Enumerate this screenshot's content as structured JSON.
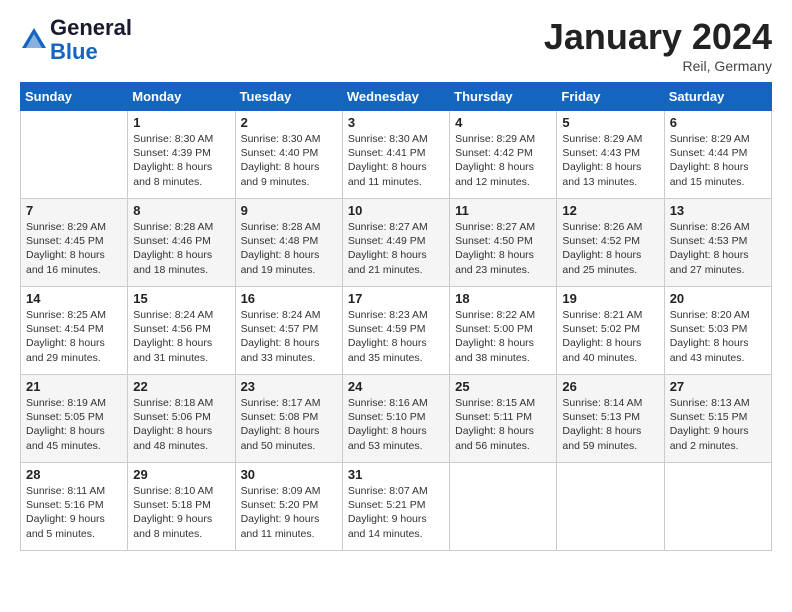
{
  "header": {
    "logo_line1": "General",
    "logo_line2": "Blue",
    "month": "January 2024",
    "location": "Reil, Germany"
  },
  "weekdays": [
    "Sunday",
    "Monday",
    "Tuesday",
    "Wednesday",
    "Thursday",
    "Friday",
    "Saturday"
  ],
  "weeks": [
    [
      {
        "day": "",
        "detail": ""
      },
      {
        "day": "1",
        "detail": "Sunrise: 8:30 AM\nSunset: 4:39 PM\nDaylight: 8 hours\nand 8 minutes."
      },
      {
        "day": "2",
        "detail": "Sunrise: 8:30 AM\nSunset: 4:40 PM\nDaylight: 8 hours\nand 9 minutes."
      },
      {
        "day": "3",
        "detail": "Sunrise: 8:30 AM\nSunset: 4:41 PM\nDaylight: 8 hours\nand 11 minutes."
      },
      {
        "day": "4",
        "detail": "Sunrise: 8:29 AM\nSunset: 4:42 PM\nDaylight: 8 hours\nand 12 minutes."
      },
      {
        "day": "5",
        "detail": "Sunrise: 8:29 AM\nSunset: 4:43 PM\nDaylight: 8 hours\nand 13 minutes."
      },
      {
        "day": "6",
        "detail": "Sunrise: 8:29 AM\nSunset: 4:44 PM\nDaylight: 8 hours\nand 15 minutes."
      }
    ],
    [
      {
        "day": "7",
        "detail": "Sunrise: 8:29 AM\nSunset: 4:45 PM\nDaylight: 8 hours\nand 16 minutes."
      },
      {
        "day": "8",
        "detail": "Sunrise: 8:28 AM\nSunset: 4:46 PM\nDaylight: 8 hours\nand 18 minutes."
      },
      {
        "day": "9",
        "detail": "Sunrise: 8:28 AM\nSunset: 4:48 PM\nDaylight: 8 hours\nand 19 minutes."
      },
      {
        "day": "10",
        "detail": "Sunrise: 8:27 AM\nSunset: 4:49 PM\nDaylight: 8 hours\nand 21 minutes."
      },
      {
        "day": "11",
        "detail": "Sunrise: 8:27 AM\nSunset: 4:50 PM\nDaylight: 8 hours\nand 23 minutes."
      },
      {
        "day": "12",
        "detail": "Sunrise: 8:26 AM\nSunset: 4:52 PM\nDaylight: 8 hours\nand 25 minutes."
      },
      {
        "day": "13",
        "detail": "Sunrise: 8:26 AM\nSunset: 4:53 PM\nDaylight: 8 hours\nand 27 minutes."
      }
    ],
    [
      {
        "day": "14",
        "detail": "Sunrise: 8:25 AM\nSunset: 4:54 PM\nDaylight: 8 hours\nand 29 minutes."
      },
      {
        "day": "15",
        "detail": "Sunrise: 8:24 AM\nSunset: 4:56 PM\nDaylight: 8 hours\nand 31 minutes."
      },
      {
        "day": "16",
        "detail": "Sunrise: 8:24 AM\nSunset: 4:57 PM\nDaylight: 8 hours\nand 33 minutes."
      },
      {
        "day": "17",
        "detail": "Sunrise: 8:23 AM\nSunset: 4:59 PM\nDaylight: 8 hours\nand 35 minutes."
      },
      {
        "day": "18",
        "detail": "Sunrise: 8:22 AM\nSunset: 5:00 PM\nDaylight: 8 hours\nand 38 minutes."
      },
      {
        "day": "19",
        "detail": "Sunrise: 8:21 AM\nSunset: 5:02 PM\nDaylight: 8 hours\nand 40 minutes."
      },
      {
        "day": "20",
        "detail": "Sunrise: 8:20 AM\nSunset: 5:03 PM\nDaylight: 8 hours\nand 43 minutes."
      }
    ],
    [
      {
        "day": "21",
        "detail": "Sunrise: 8:19 AM\nSunset: 5:05 PM\nDaylight: 8 hours\nand 45 minutes."
      },
      {
        "day": "22",
        "detail": "Sunrise: 8:18 AM\nSunset: 5:06 PM\nDaylight: 8 hours\nand 48 minutes."
      },
      {
        "day": "23",
        "detail": "Sunrise: 8:17 AM\nSunset: 5:08 PM\nDaylight: 8 hours\nand 50 minutes."
      },
      {
        "day": "24",
        "detail": "Sunrise: 8:16 AM\nSunset: 5:10 PM\nDaylight: 8 hours\nand 53 minutes."
      },
      {
        "day": "25",
        "detail": "Sunrise: 8:15 AM\nSunset: 5:11 PM\nDaylight: 8 hours\nand 56 minutes."
      },
      {
        "day": "26",
        "detail": "Sunrise: 8:14 AM\nSunset: 5:13 PM\nDaylight: 8 hours\nand 59 minutes."
      },
      {
        "day": "27",
        "detail": "Sunrise: 8:13 AM\nSunset: 5:15 PM\nDaylight: 9 hours\nand 2 minutes."
      }
    ],
    [
      {
        "day": "28",
        "detail": "Sunrise: 8:11 AM\nSunset: 5:16 PM\nDaylight: 9 hours\nand 5 minutes."
      },
      {
        "day": "29",
        "detail": "Sunrise: 8:10 AM\nSunset: 5:18 PM\nDaylight: 9 hours\nand 8 minutes."
      },
      {
        "day": "30",
        "detail": "Sunrise: 8:09 AM\nSunset: 5:20 PM\nDaylight: 9 hours\nand 11 minutes."
      },
      {
        "day": "31",
        "detail": "Sunrise: 8:07 AM\nSunset: 5:21 PM\nDaylight: 9 hours\nand 14 minutes."
      },
      {
        "day": "",
        "detail": ""
      },
      {
        "day": "",
        "detail": ""
      },
      {
        "day": "",
        "detail": ""
      }
    ]
  ]
}
